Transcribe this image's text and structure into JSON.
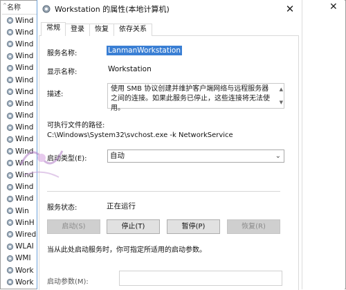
{
  "background_list": {
    "header": "名称",
    "rows": [
      "Wind",
      "Wind",
      "Wind",
      "Wind",
      "Wind",
      "Wind",
      "Wind",
      "Wind",
      "Wind",
      "Wind",
      "Wind",
      "Wind",
      "Wind",
      "Wind",
      "Wind",
      "Wind",
      "Win",
      "WinH",
      "Wired",
      "WLAI",
      "WMI",
      "Work",
      "Work"
    ]
  },
  "dialog": {
    "title": "Workstation 的属性(本地计算机)",
    "close_glyph": "✕",
    "tabs": [
      "常规",
      "登录",
      "恢复",
      "依存关系"
    ],
    "service_name_label": "服务名称:",
    "service_name_value": "LanmanWorkstation",
    "display_name_label": "显示名称:",
    "display_name_value": "Workstation",
    "description_label": "描述:",
    "description_value": "使用 SMB 协议创建并维护客户端网络与远程服务器之间的连接。如果此服务已停止，这些连接将无法使用。",
    "path_label": "可执行文件的路径:",
    "path_value": "C:\\Windows\\System32\\svchost.exe -k NetworkService",
    "startup_type_label": "启动类型(E):",
    "startup_type_value": "自动",
    "status_label": "服务状态:",
    "status_value": "正在运行",
    "buttons": {
      "start": "启动(S)",
      "stop": "停止(T)",
      "pause": "暂停(P)",
      "resume": "恢复(R)"
    },
    "hint": "当从此处启动服务时，你可指定所适用的启动参数。",
    "start_params_label": "启动参数(M):"
  },
  "colors": {
    "selection": "#3a7fd4",
    "button_bg": "#e1e1e1",
    "button_disabled_bg": "#cfcfcf"
  }
}
